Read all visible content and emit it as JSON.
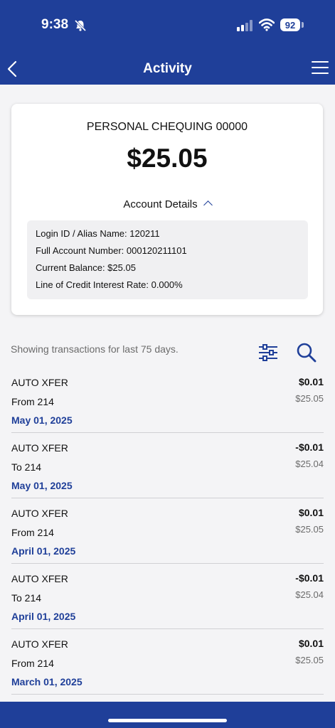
{
  "status_bar": {
    "time": "9:38",
    "battery": "92"
  },
  "header": {
    "title": "Activity"
  },
  "account": {
    "name": "PERSONAL CHEQUING 00000",
    "balance": "$25.05",
    "details_label": "Account Details",
    "details": [
      "Login ID / Alias Name: 120211",
      "Full Account Number: 000120211101",
      "Current Balance: $25.05",
      "Line of Credit Interest Rate: 0.000%"
    ]
  },
  "filter_text": "Showing transactions for last 75 days.",
  "transactions": [
    {
      "desc": "AUTO XFER",
      "sub": "From 214",
      "date": "May 01, 2025",
      "amount": "$0.01",
      "balance": "$25.05"
    },
    {
      "desc": "AUTO XFER",
      "sub": "To 214",
      "date": "May 01, 2025",
      "amount": "-$0.01",
      "balance": "$25.04"
    },
    {
      "desc": "AUTO XFER",
      "sub": "From 214",
      "date": "April 01, 2025",
      "amount": "$0.01",
      "balance": "$25.05"
    },
    {
      "desc": "AUTO XFER",
      "sub": "To 214",
      "date": "April 01, 2025",
      "amount": "-$0.01",
      "balance": "$25.04"
    },
    {
      "desc": "AUTO XFER",
      "sub": "From 214",
      "date": "March 01, 2025",
      "amount": "$0.01",
      "balance": "$25.05"
    }
  ],
  "icons": {
    "back": "chevron-left-icon",
    "menu": "hamburger-icon",
    "filter": "sliders-icon",
    "search": "search-icon"
  },
  "colors": {
    "brand": "#1f3f99",
    "background": "#f4f4f6"
  }
}
